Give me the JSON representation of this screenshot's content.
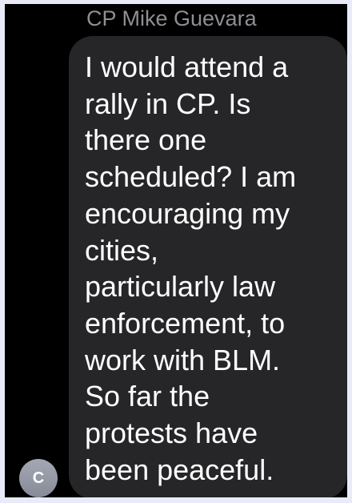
{
  "conversation": {
    "sender_name": "CP Mike Guevara",
    "avatar_initial": "C",
    "message": {
      "lines": [
        " I would attend a",
        "rally in CP.  Is",
        "there one",
        "scheduled?  I am",
        "encouraging my",
        "cities,",
        "particularly law",
        "enforcement, to",
        "work with BLM.",
        "So far the",
        "protests have",
        "been peaceful."
      ]
    }
  },
  "colors": {
    "background": "#000000",
    "bubble": "#262628",
    "text": "#ffffff",
    "sender_name": "#8e8e93",
    "avatar": "#9a9eab",
    "frame": "#e9ebf8"
  }
}
